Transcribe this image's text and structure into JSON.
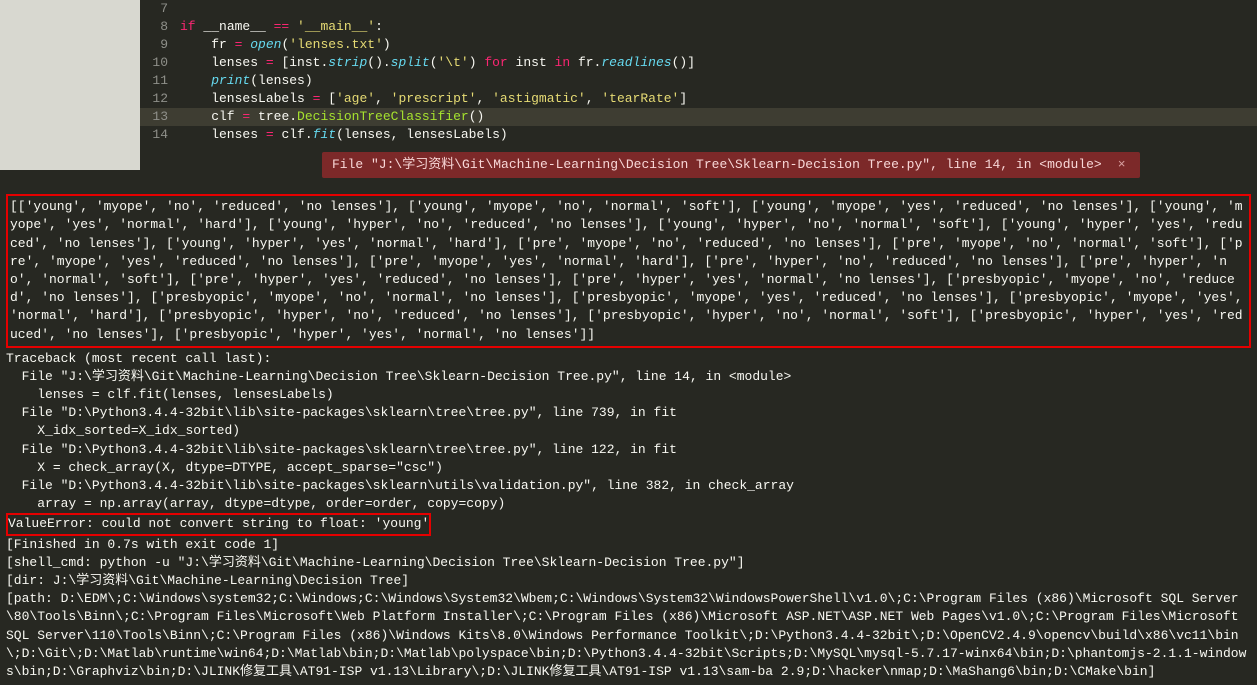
{
  "code": {
    "lines": [
      {
        "num": "7",
        "content": ""
      },
      {
        "num": "8",
        "content": "if __name__ == '__main__':"
      },
      {
        "num": "9",
        "content": "    fr = open('lenses.txt')"
      },
      {
        "num": "10",
        "content": "    lenses = [inst.strip().split('\\t') for inst in fr.readlines()]"
      },
      {
        "num": "11",
        "content": "    print(lenses)"
      },
      {
        "num": "12",
        "content": "    lensesLabels = ['age', 'prescript', 'astigmatic', 'tearRate']"
      },
      {
        "num": "13",
        "content": "    clf = tree.DecisionTreeClassifier()"
      },
      {
        "num": "14",
        "content": "    lenses = clf.fit(lenses, lensesLabels)"
      }
    ]
  },
  "error_bar": {
    "text": "File \"J:\\学习资料\\Git\\Machine-Learning\\Decision Tree\\Sklearn-Decision Tree.py\", line 14, in <module>",
    "close": "×"
  },
  "output": {
    "data_print": "[['young', 'myope', 'no', 'reduced', 'no lenses'], ['young', 'myope', 'no', 'normal', 'soft'], ['young', 'myope', 'yes', 'reduced', 'no lenses'], ['young', 'myope', 'yes', 'normal', 'hard'], ['young', 'hyper', 'no', 'reduced', 'no lenses'], ['young', 'hyper', 'no', 'normal', 'soft'], ['young', 'hyper', 'yes', 'reduced', 'no lenses'], ['young', 'hyper', 'yes', 'normal', 'hard'], ['pre', 'myope', 'no', 'reduced', 'no lenses'], ['pre', 'myope', 'no', 'normal', 'soft'], ['pre', 'myope', 'yes', 'reduced', 'no lenses'], ['pre', 'myope', 'yes', 'normal', 'hard'], ['pre', 'hyper', 'no', 'reduced', 'no lenses'], ['pre', 'hyper', 'no', 'normal', 'soft'], ['pre', 'hyper', 'yes', 'reduced', 'no lenses'], ['pre', 'hyper', 'yes', 'normal', 'no lenses'], ['presbyopic', 'myope', 'no', 'reduced', 'no lenses'], ['presbyopic', 'myope', 'no', 'normal', 'no lenses'], ['presbyopic', 'myope', 'yes', 'reduced', 'no lenses'], ['presbyopic', 'myope', 'yes', 'normal', 'hard'], ['presbyopic', 'hyper', 'no', 'reduced', 'no lenses'], ['presbyopic', 'hyper', 'no', 'normal', 'soft'], ['presbyopic', 'hyper', 'yes', 'reduced', 'no lenses'], ['presbyopic', 'hyper', 'yes', 'normal', 'no lenses']]",
    "traceback_header": "Traceback (most recent call last):",
    "tb1": "  File \"J:\\学习资料\\Git\\Machine-Learning\\Decision Tree\\Sklearn-Decision Tree.py\", line 14, in <module>",
    "tb1c": "    lenses = clf.fit(lenses, lensesLabels)",
    "tb2": "  File \"D:\\Python3.4.4-32bit\\lib\\site-packages\\sklearn\\tree\\tree.py\", line 739, in fit",
    "tb2c": "    X_idx_sorted=X_idx_sorted)",
    "tb3": "  File \"D:\\Python3.4.4-32bit\\lib\\site-packages\\sklearn\\tree\\tree.py\", line 122, in fit",
    "tb3c": "    X = check_array(X, dtype=DTYPE, accept_sparse=\"csc\")",
    "tb4": "  File \"D:\\Python3.4.4-32bit\\lib\\site-packages\\sklearn\\utils\\validation.py\", line 382, in check_array",
    "tb4c": "    array = np.array(array, dtype=dtype, order=order, copy=copy)",
    "value_error": "ValueError: could not convert string to float: 'young'",
    "finished": "[Finished in 0.7s with exit code 1]",
    "shell_cmd": "[shell_cmd: python -u \"J:\\学习资料\\Git\\Machine-Learning\\Decision Tree\\Sklearn-Decision Tree.py\"]",
    "dir": "[dir: J:\\学习资料\\Git\\Machine-Learning\\Decision Tree]",
    "path": "[path: D:\\EDM\\;C:\\Windows\\system32;C:\\Windows;C:\\Windows\\System32\\Wbem;C:\\Windows\\System32\\WindowsPowerShell\\v1.0\\;C:\\Program Files (x86)\\Microsoft SQL Server\\80\\Tools\\Binn\\;C:\\Program Files\\Microsoft\\Web Platform Installer\\;C:\\Program Files (x86)\\Microsoft ASP.NET\\ASP.NET Web Pages\\v1.0\\;C:\\Program Files\\Microsoft SQL Server\\110\\Tools\\Binn\\;C:\\Program Files (x86)\\Windows Kits\\8.0\\Windows Performance Toolkit\\;D:\\Python3.4.4-32bit\\;D:\\OpenCV2.4.9\\opencv\\build\\x86\\vc11\\bin\\;D:\\Git\\;D:\\Matlab\\runtime\\win64;D:\\Matlab\\bin;D:\\Matlab\\polyspace\\bin;D:\\Python3.4.4-32bit\\Scripts;D:\\MySQL\\mysql-5.7.17-winx64\\bin;D:\\phantomjs-2.1.1-windows\\bin;D:\\Graphviz\\bin;D:\\JLINK修复工具\\AT91-ISP v1.13\\Library\\;D:\\JLINK修复工具\\AT91-ISP v1.13\\sam-ba 2.9;D:\\hacker\\nmap;D:\\MaShang6\\bin;D:\\CMake\\bin]"
  }
}
